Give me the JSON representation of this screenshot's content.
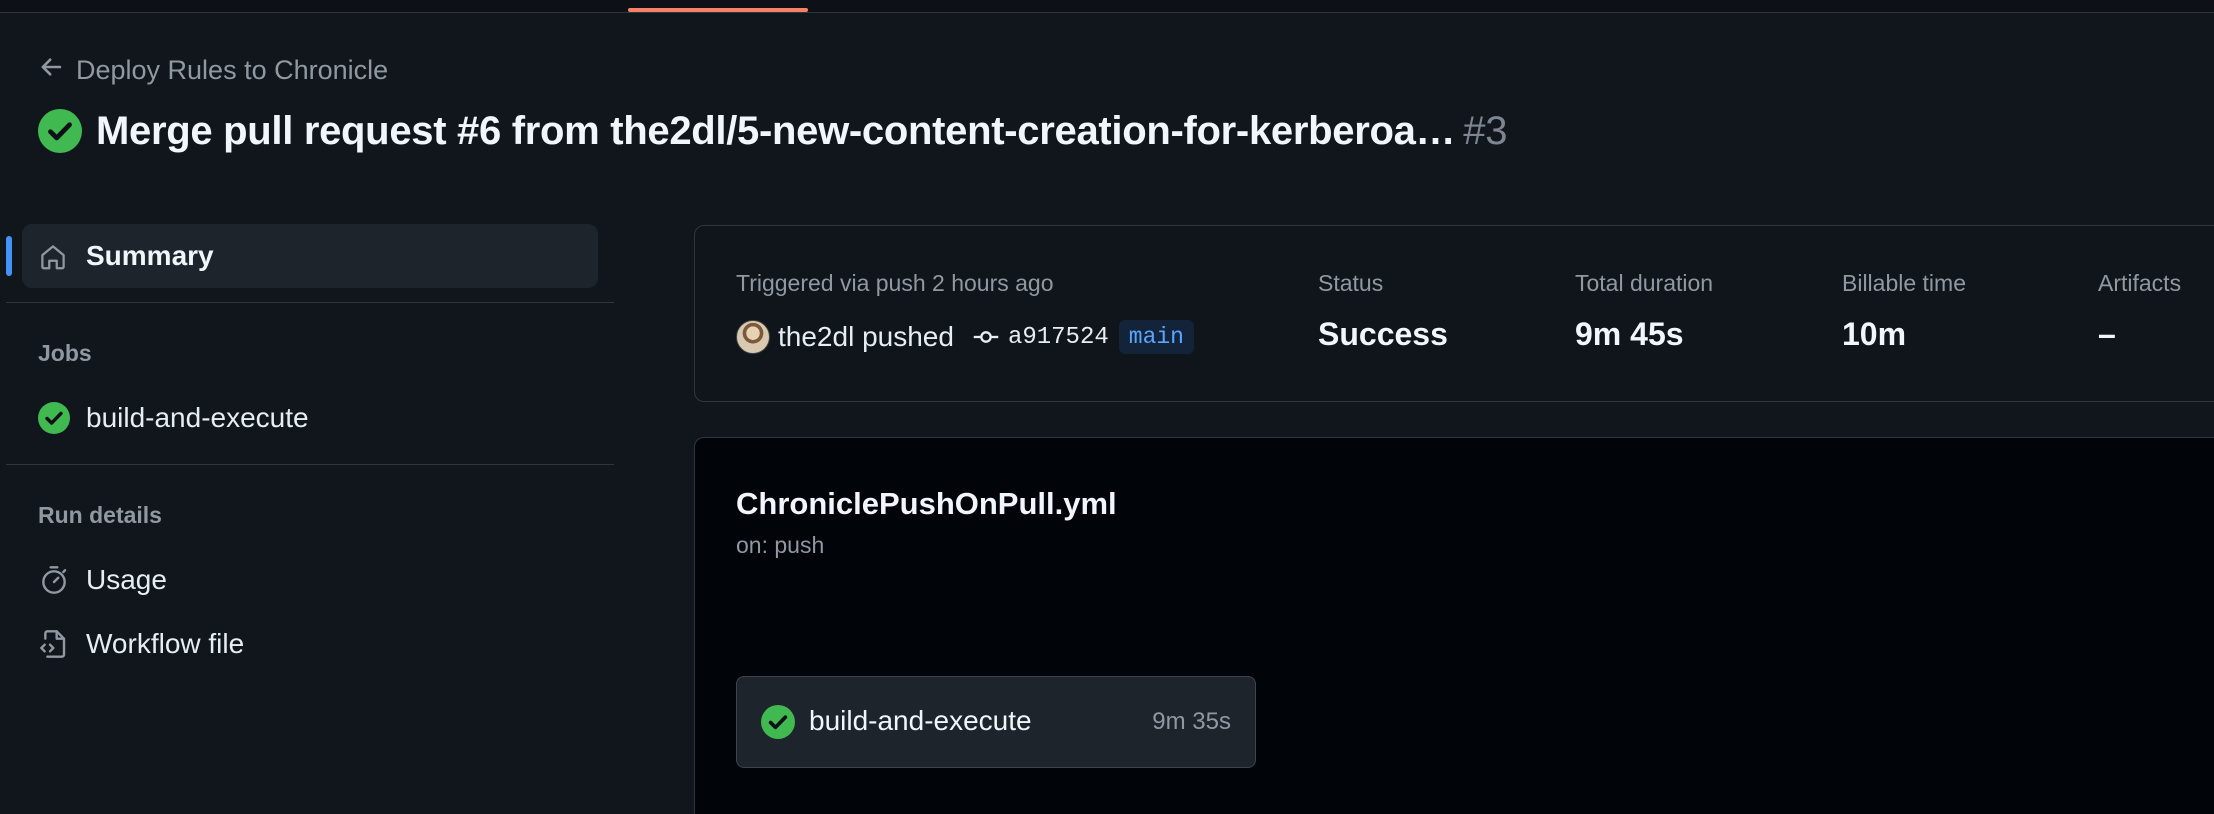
{
  "back_link": {
    "label": "Deploy Rules to Chronicle"
  },
  "run": {
    "title": "Merge pull request #6 from the2dl/5-new-content-creation-for-kerberoa…",
    "number": "#3",
    "status_icon": "check-circle-icon"
  },
  "sidebar": {
    "summary_label": "Summary",
    "jobs_heading": "Jobs",
    "jobs": [
      {
        "label": "build-and-execute",
        "status": "success"
      }
    ],
    "run_details_heading": "Run details",
    "run_details": [
      {
        "label": "Usage",
        "icon": "stopwatch-icon"
      },
      {
        "label": "Workflow file",
        "icon": "file-code-icon"
      }
    ]
  },
  "summary": {
    "triggered_text": "Triggered via push 2 hours ago",
    "pusher": "the2dl pushed",
    "commit_sha": "a917524",
    "branch": "main",
    "stats": {
      "status_label": "Status",
      "status_value": "Success",
      "duration_label": "Total duration",
      "duration_value": "9m 45s",
      "billable_label": "Billable time",
      "billable_value": "10m",
      "artifacts_label": "Artifacts",
      "artifacts_value": "–"
    }
  },
  "workflow": {
    "file_name": "ChroniclePushOnPull.yml",
    "trigger": "on: push",
    "job": {
      "name": "build-and-execute",
      "duration": "9m 35s"
    }
  },
  "colors": {
    "background": "#11161d",
    "success_green": "#3fb950",
    "accent_blue": "#4493f8",
    "tab_underline": "#f78166"
  }
}
